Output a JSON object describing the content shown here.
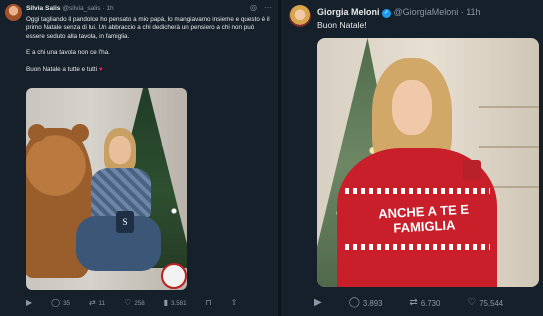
{
  "left_tweet": {
    "author_name": "Silvia Salis",
    "handle_time": "@silvia_salis · 1h",
    "paragraphs": [
      "Oggi tagliando il pandolce ho pensato a mio papà, lo mangiavamo insieme e questo è il primo Natale senza di lui. Un abbraccio a chi dedicherà un pensiero a chi non può essere seduto alla tavola, in famiglia.",
      "E a chi una tavola non ce l'ha.",
      "Buon Natale a tutte e tutti"
    ],
    "mug_letter": "S",
    "actions": {
      "replies": "35",
      "reposts": "11",
      "likes": "258",
      "views": "3.581"
    }
  },
  "right_tweet": {
    "author_name": "Giorgia Meloni",
    "handle_time": "@GiorgiaMeloni · 11h",
    "text": "Buon Natale!",
    "sweater_text": "ANCHE A TE E FAMIGLIA",
    "actions": {
      "replies": "3.893",
      "reposts": "6.730",
      "likes": "75.544"
    }
  },
  "icons": {
    "reply": "reply-icon",
    "repost": "repost-icon",
    "like": "heart-icon",
    "views": "views-icon",
    "bookmark": "bookmark-icon",
    "share": "share-icon",
    "play": "play-icon",
    "grok": "grok-icon",
    "more": "more-icon",
    "verified": "verified-badge-icon"
  },
  "colors": {
    "background": "#15202b",
    "text": "#e7e9ea",
    "muted": "#8b98a5",
    "accent": "#1d9bf0",
    "heart": "#f91880"
  }
}
